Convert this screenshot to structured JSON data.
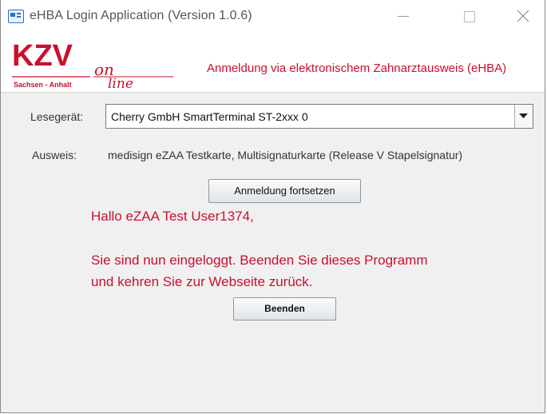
{
  "window": {
    "title": "eHBA Login Application (Version 1.0.6)",
    "icons": {
      "app": "id-card-icon",
      "minimize": "minimize-icon",
      "maximize": "maximize-icon",
      "close": "close-icon"
    }
  },
  "banner": {
    "logo": {
      "main": "KZV",
      "sub": "Sachsen - Anhalt",
      "on": "on",
      "line": "line"
    },
    "title": "Anmeldung via elektronischem Zahnarztausweis (eHBA)"
  },
  "form": {
    "reader_label": "Lesegerät:",
    "reader_value": "Cherry GmbH SmartTerminal ST-2xxx 0",
    "card_label": "Ausweis:",
    "card_value": "medisign eZAA Testkarte, Multisignaturkarte (Release V Stapelsignatur)",
    "continue_button": "Anmeldung fortsetzen"
  },
  "message": {
    "greeting": "Hallo eZAA Test User1374,",
    "line1": "Sie sind nun eingeloggt. Beenden Sie dieses Programm",
    "line2": "und kehren Sie zur Webseite zurück.",
    "exit_button": "Beenden"
  },
  "colors": {
    "accent_red": "#c8102e",
    "window_bg": "#f0f0f0"
  }
}
